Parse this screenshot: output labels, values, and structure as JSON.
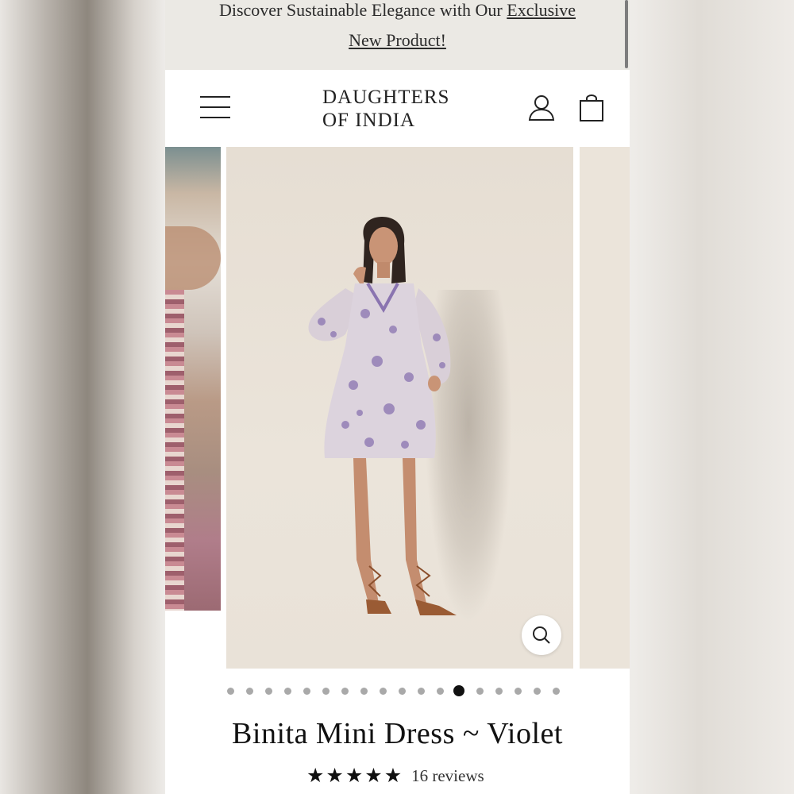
{
  "announcement": {
    "text_before": "Discover Sustainable Elegance with Our ",
    "link_line1": "Exclusive",
    "link_line2": "New Product!"
  },
  "header": {
    "logo_line1": "DAUGHTERS",
    "logo_line2": "OF INDIA",
    "menu_icon": "hamburger-icon",
    "account_icon": "user-icon",
    "cart_icon": "shopping-bag-icon"
  },
  "gallery": {
    "zoom_icon": "magnifier-icon",
    "dot_count": 18,
    "active_dot": 13
  },
  "product": {
    "title": "Binita Mini Dress ~ Violet",
    "rating": 5,
    "reviews_label": "16 reviews"
  },
  "colors": {
    "announcement_bg": "#ebe9e4",
    "text": "#111111",
    "dress_violet": "#8a74b0"
  }
}
